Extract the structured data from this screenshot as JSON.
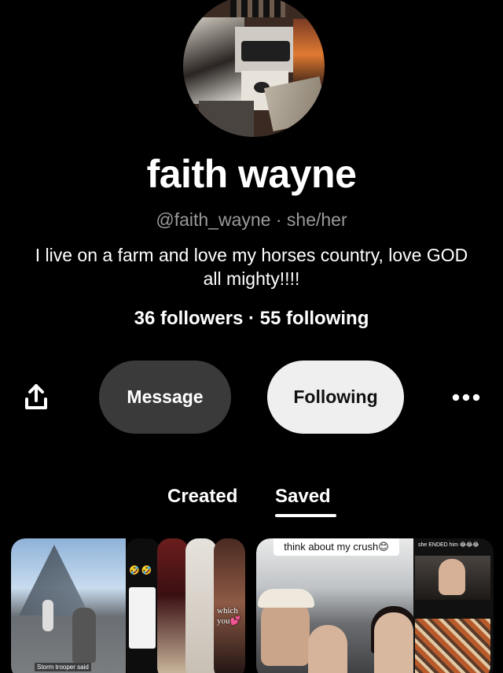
{
  "profile": {
    "name": "faith wayne",
    "handle_line": "@faith_wayne · she/her",
    "bio": "I live on a farm and love my horses country, love GOD all mighty!!!!",
    "stats": "36 followers · 55 following"
  },
  "actions": {
    "message_label": "Message",
    "following_label": "Following"
  },
  "tabs": [
    {
      "label": "Created",
      "active": false
    },
    {
      "label": "Saved",
      "active": true
    }
  ],
  "boards": [
    {
      "captions": {
        "storm_trooper": "Storm trooper said",
        "which_you": "which you💕"
      }
    },
    {
      "captions": {
        "crush": "think about my crush😊",
        "ended": "she ENDED him 😂😂😂"
      }
    }
  ],
  "icons": {
    "share": "share-icon",
    "more": "more-options-icon"
  },
  "colors": {
    "background": "#000000",
    "message_button": "#3a3a3a",
    "following_button": "#efefef",
    "muted_text": "#9a9a9a"
  }
}
